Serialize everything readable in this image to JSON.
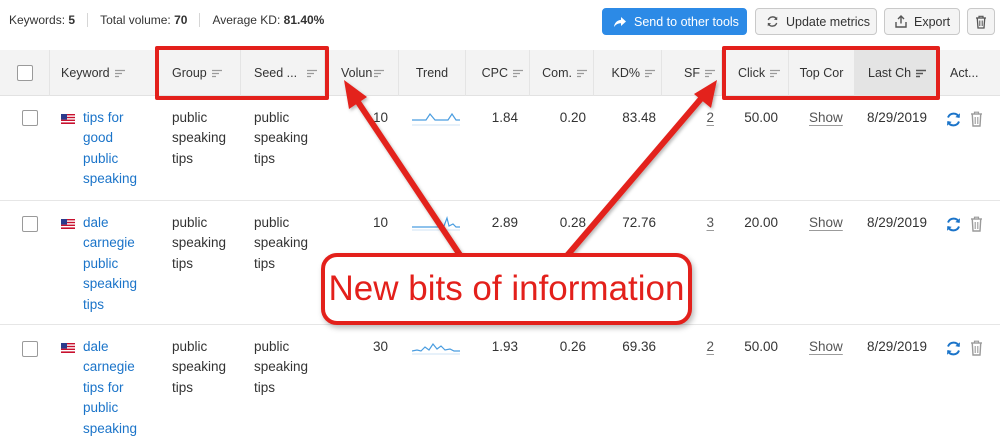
{
  "summary": {
    "keywords_label": "Keywords:",
    "keywords_value": "5",
    "volume_label": "Total volume:",
    "volume_value": "70",
    "kd_label": "Average KD:",
    "kd_value": "81.40%"
  },
  "toolbar": {
    "send_label": "Send to other tools",
    "update_label": "Update metrics",
    "export_label": "Export"
  },
  "columns": {
    "keyword": "Keyword",
    "group": "Group",
    "seed": "Seed ...",
    "volume": "Volun",
    "trend": "Trend",
    "cpc": "CPC",
    "com": "Com.",
    "kd": "KD%",
    "sf": "SF",
    "clicks": "Click",
    "top": "Top Cor",
    "last": "Last Ch",
    "actions": "Act..."
  },
  "rows": [
    {
      "keyword_lines": [
        "tips for",
        "good",
        "public",
        "speaking"
      ],
      "group_lines": [
        "public",
        "speaking",
        "tips"
      ],
      "seed_lines": [
        "public",
        "speaking",
        "tips"
      ],
      "volume": "10",
      "cpc": "1.84",
      "com": "0.20",
      "kd": "83.48",
      "sf": "2",
      "clicks": "50.00",
      "top": "Show",
      "last": "8/29/2019"
    },
    {
      "keyword_lines": [
        "dale",
        "carnegie",
        "public",
        "speaking",
        "tips"
      ],
      "group_lines": [
        "public",
        "speaking",
        "tips"
      ],
      "seed_lines": [
        "public",
        "speaking",
        "tips"
      ],
      "volume": "10",
      "cpc": "2.89",
      "com": "0.28",
      "kd": "72.76",
      "sf": "3",
      "clicks": "20.00",
      "top": "Show",
      "last": "8/29/2019"
    },
    {
      "keyword_lines": [
        "dale",
        "carnegie",
        "tips for",
        "public",
        "speaking"
      ],
      "group_lines": [
        "public",
        "speaking",
        "tips"
      ],
      "seed_lines": [
        "public",
        "speaking",
        "tips"
      ],
      "volume": "30",
      "cpc": "1.93",
      "com": "0.26",
      "kd": "69.36",
      "sf": "2",
      "clicks": "50.00",
      "top": "Show",
      "last": "8/29/2019"
    }
  ],
  "annotation": {
    "callout_text": "New bits of information",
    "color": "#e3201b"
  },
  "colors": {
    "primary_button": "#2c8ae6",
    "keyword_link": "#1b74c9",
    "header_bg": "#f3f3f3"
  },
  "icons": {
    "send": "share-arrow-icon",
    "update": "refresh-icon",
    "export": "upload-icon",
    "delete": "trash-icon",
    "sort": "sort-lines-icon",
    "flag": "us-flag-icon"
  }
}
